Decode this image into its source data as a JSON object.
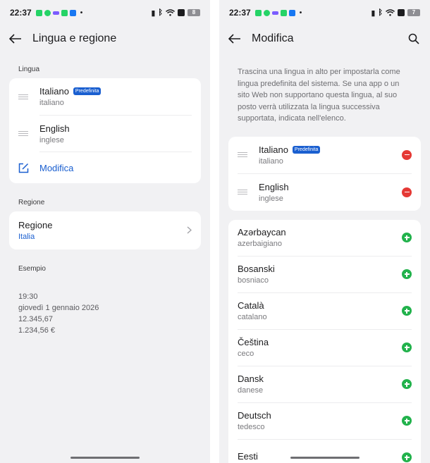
{
  "left": {
    "status": {
      "time": "22:37",
      "battery": "8"
    },
    "header": {
      "title": "Lingua e regione"
    },
    "language_section": {
      "label": "Lingua",
      "items": [
        {
          "name": "Italiano",
          "badge": "Predefinita",
          "sub": "italiano"
        },
        {
          "name": "English",
          "sub": "inglese"
        }
      ],
      "edit_label": "Modifica"
    },
    "region_section": {
      "label": "Regione",
      "title": "Regione",
      "value": "Italia"
    },
    "example": {
      "label": "Esempio",
      "lines": [
        "19:30",
        "giovedì 1 gennaio 2026",
        "12.345,67",
        "1.234,56 €"
      ]
    }
  },
  "right": {
    "status": {
      "time": "22:37",
      "battery": "7"
    },
    "header": {
      "title": "Modifica"
    },
    "intro": "Trascina una lingua in alto per impostarla come lingua predefinita del sistema. Se una app o un sito Web non supportano questa lingua, al suo posto verrà utilizzata la lingua successiva supportata, indicata nell'elenco.",
    "selected": [
      {
        "name": "Italiano",
        "badge": "Predefinita",
        "sub": "italiano"
      },
      {
        "name": "English",
        "sub": "inglese"
      }
    ],
    "available": [
      {
        "name": "Azərbaycan",
        "sub": "azerbaigiano"
      },
      {
        "name": "Bosanski",
        "sub": "bosniaco"
      },
      {
        "name": "Català",
        "sub": "catalano"
      },
      {
        "name": "Čeština",
        "sub": "ceco"
      },
      {
        "name": "Dansk",
        "sub": "danese"
      },
      {
        "name": "Deutsch",
        "sub": "tedesco"
      },
      {
        "name": "Eesti",
        "sub": ""
      }
    ]
  },
  "colors": {
    "accent": "#1a5fd0",
    "remove": "#e53935",
    "add": "#22b24c",
    "background": "#f1f1f3"
  },
  "icons": [
    "back-arrow-icon",
    "search-icon",
    "drag-handle-icon",
    "edit-icon",
    "chevron-right-icon",
    "remove-icon",
    "add-icon"
  ]
}
